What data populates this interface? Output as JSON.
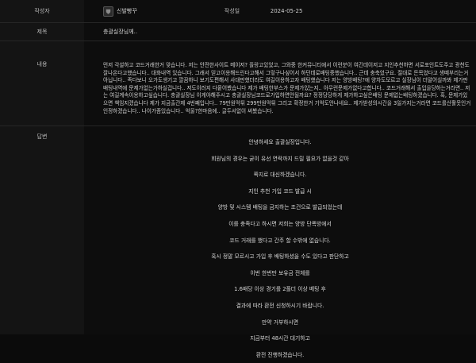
{
  "post": {
    "author_label": "작성자",
    "author": "신발빵꾸",
    "date_label": "작성일",
    "date": "2024-05-25",
    "title_label": "제목",
    "title": "충괄실장님께..",
    "content_label": "내용",
    "content": "먼저 각설하고 코드거래한거 맞습니다. 저는 안전한사이트 메이저? 플랑고있었고, 그와중 한커뮤니티에서 이런분이 여긴데이저고 지인추천하면 서로포인트도주고 광천도 잘나온다고했습니다.. 대화내역 있습니다. 그래서 믿고이용해드린다고해서 그렇구나싶어서 하던데로배팅중했습니다.. 근데 충축었구요. 절대로 돈목었다고 생떼부리는거아닙니다.. 족다보니 오가도생기고 깔끔하니 보기도편해서 사대만했더라도 여길이용하고자 배팅했습니다 저는 양방배팅?에 양차도모르고 실장님이 더말어실까봐 제가판배팅내역에 문제가없는가하실겁니다.. 저도이러지 다뭍어봤습니다 제가 배팅한부스가 문제가있는지.. 아무런문제가없다고합니다.. 코드거래해서 출입을당하는거라면.. 저는 여길계속이용하고싶습니다. 충괄실장님 이게야해주시고 충괄실장님코드로가입하면안될까요? 정정당당하게 제가하고싶은배팅 문제없는배팅하겠습니다. 혹, 문제가있으면 책임지겠습니다 제가 지금출간제 4번째입니다.. 79만원먹튀 299만원먹튀 그리고 확정한거 기억도안나네요.. 제가받성의시간을 3일가지는거라면 코드를산활못인거인정하겠습니다.. 나이가좀있습니다.. 억울?한마음에.. 글두서없이 써봤습니다.",
    "answer_label": "답변",
    "answer_lines": [
      "안녕하세요 출괄실장입니다.",
      "회원님의 경우는 굳이 유선 연락까지 드릴 필요가 없을것 같아",
      "쪽지로 대신하겠습니다.",
      "지인 추천 가입 코드 발급 시",
      "양방 및 시스템 배팅을 금지하는 조건으로 발급되었는데",
      "이를 충족다고 하시면 저희는 양방 단폭방에서",
      "코드 거래를 했다고 간주 할 수밖에 없습니다.",
      "혹시 정말 모르시고 가입 후 배팅하셨을 수도 있다고 판단하고",
      "이번 한번만 보유금 전체를",
      "1.6배당 이상 경기를 2폴더 이상 베팅 후",
      "결과에 따라 환전 신청하시기 바랍니다.",
      "만약 거부하시면",
      "지금부터 48시간 대기하고",
      "환전 진행하겠습니다."
    ]
  }
}
